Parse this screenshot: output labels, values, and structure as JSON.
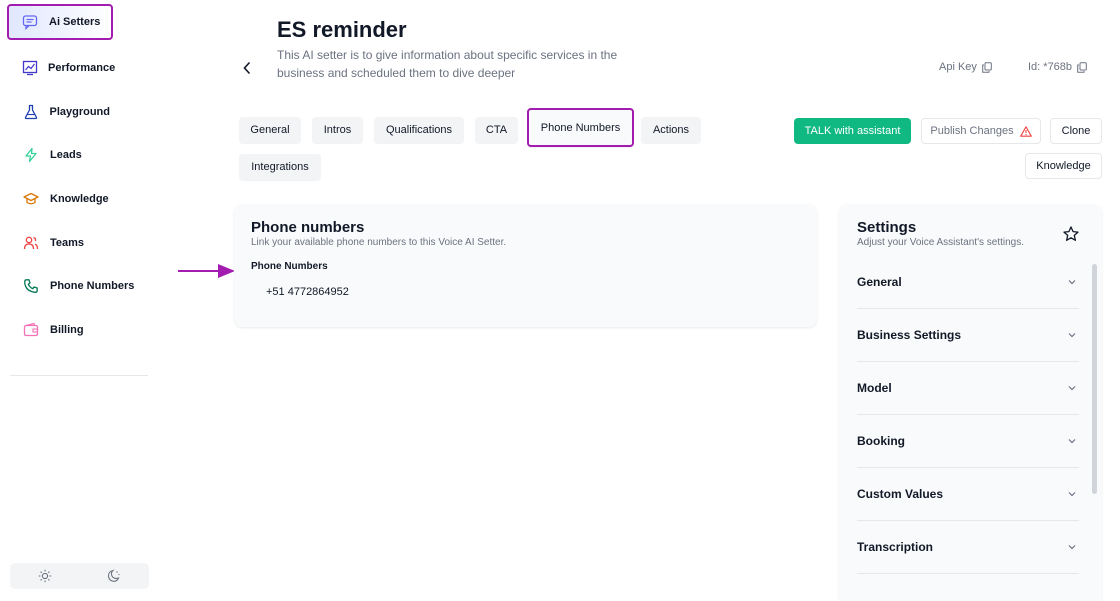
{
  "sidebar": {
    "items": [
      {
        "label": "Ai Setters",
        "icon": "chat-bubble-icon",
        "active": true
      },
      {
        "label": "Performance",
        "icon": "chart-icon"
      },
      {
        "label": "Playground",
        "icon": "flask-icon"
      },
      {
        "label": "Leads",
        "icon": "lightning-icon"
      },
      {
        "label": "Knowledge",
        "icon": "graduation-cap-icon"
      },
      {
        "label": "Teams",
        "icon": "users-icon"
      },
      {
        "label": "Phone Numbers",
        "icon": "phone-icon"
      },
      {
        "label": "Billing",
        "icon": "wallet-icon"
      }
    ],
    "theme_icons": [
      "sun-icon",
      "moon-icon"
    ]
  },
  "header": {
    "title": "ES reminder",
    "description": "This AI setter is to give information about specific services in the business and scheduled them to dive deeper",
    "api_key_label": "Api Key",
    "id_label": "Id: *768b"
  },
  "tabs": [
    {
      "label": "General"
    },
    {
      "label": "Intros"
    },
    {
      "label": "Qualifications"
    },
    {
      "label": "CTA"
    },
    {
      "label": "Phone Numbers",
      "active": true
    },
    {
      "label": "Actions"
    },
    {
      "label": "Integrations"
    }
  ],
  "actions": {
    "talk_label": "TALK with assistant",
    "publish_label": "Publish Changes",
    "clone_label": "Clone",
    "knowledge_label": "Knowledge"
  },
  "phone_panel": {
    "title": "Phone numbers",
    "subtitle": "Link your available phone numbers to this Voice AI Setter.",
    "field_label": "Phone Numbers",
    "value": "+51 4772864952"
  },
  "settings": {
    "title": "Settings",
    "subtitle": "Adjust your Voice Assistant's settings.",
    "sections": [
      {
        "label": "General"
      },
      {
        "label": "Business Settings"
      },
      {
        "label": "Model"
      },
      {
        "label": "Booking"
      },
      {
        "label": "Custom Values"
      },
      {
        "label": "Transcription"
      }
    ]
  },
  "colors": {
    "accent_purple": "#a21caf",
    "talk_green": "#10b981",
    "warning": "#ef4444"
  }
}
